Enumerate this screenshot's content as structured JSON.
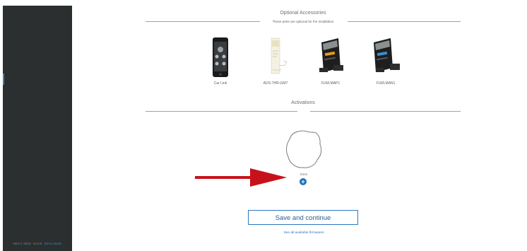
{
  "sidebar": {
    "footer_text": "ADS © 2018 - v2.8.5",
    "footer_link": "Demo Mode"
  },
  "accessories": {
    "title": "Optional Accessories",
    "subtitle": "These parts are optional for the installation",
    "items": [
      {
        "label": "Car Link",
        "icon": "smartphone-icon"
      },
      {
        "label": "ADS-THR-GM7",
        "icon": "module-box-icon"
      },
      {
        "label": "FLWLMAP1",
        "icon": "module-box-icon"
      },
      {
        "label": "FLWLMAN1",
        "icon": "module-box-icon"
      }
    ]
  },
  "activations": {
    "title": "Activations",
    "items": [
      {
        "label": "Siren",
        "add_icon": "plus-circle-icon"
      }
    ]
  },
  "actions": {
    "save_label": "Save and continue",
    "firmware_link": "See all available firmwares"
  },
  "colors": {
    "sidebar": "#2b2f30",
    "accent": "#2a78c2",
    "arrow": "#c8121b"
  }
}
